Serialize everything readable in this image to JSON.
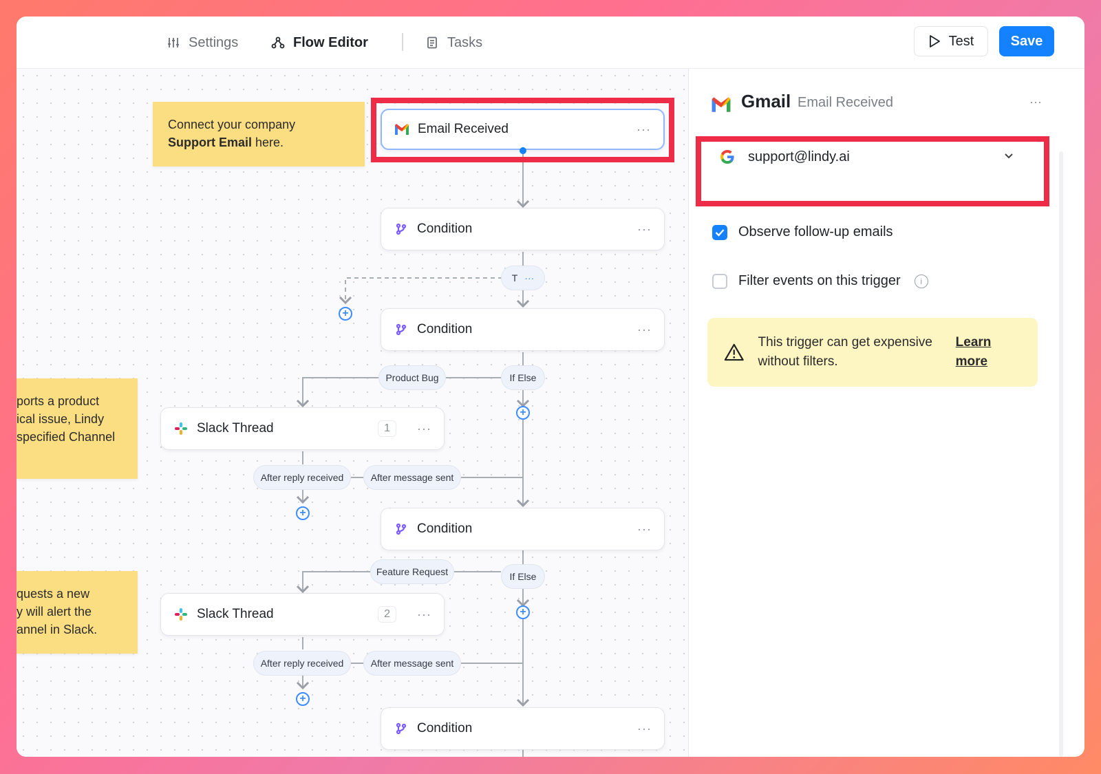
{
  "nav": {
    "settings": "Settings",
    "flow_editor": "Flow Editor",
    "tasks": "Tasks",
    "test": "Test",
    "save": "Save"
  },
  "notes": {
    "note1_line1": "Connect your company",
    "note1_bold": "Support Email",
    "note1_rest": " here.",
    "note2_lines": [
      "ports a product",
      "ical issue, Lindy",
      "specified Channel"
    ],
    "note3_lines": [
      "quests a new",
      "y will alert the",
      "annel in Slack."
    ]
  },
  "nodes": {
    "email_received": "Email Received",
    "condition": "Condition",
    "slack_thread": "Slack Thread",
    "slack_count_1": "1",
    "slack_count_2": "2",
    "dots": "···"
  },
  "pills": {
    "t": "T",
    "t_dots": "···",
    "product_bug": "Product Bug",
    "if_else": "If Else",
    "after_reply": "After reply received",
    "after_message": "After message sent",
    "feature_request": "Feature Request"
  },
  "panel": {
    "title": "Gmail",
    "subtitle": "Email Received",
    "dots": "···",
    "account": "support@lindy.ai",
    "observe": "Observe follow-up emails",
    "observe_checked": true,
    "filter": "Filter events on this trigger",
    "filter_checked": false,
    "warning": "This trigger can get expensive without filters.",
    "learn_more": "Learn more"
  },
  "colors": {
    "accent": "#1482ff",
    "highlight": "#ee2c47",
    "note": "#fcde82",
    "warning_bg": "#fdf5c2"
  }
}
